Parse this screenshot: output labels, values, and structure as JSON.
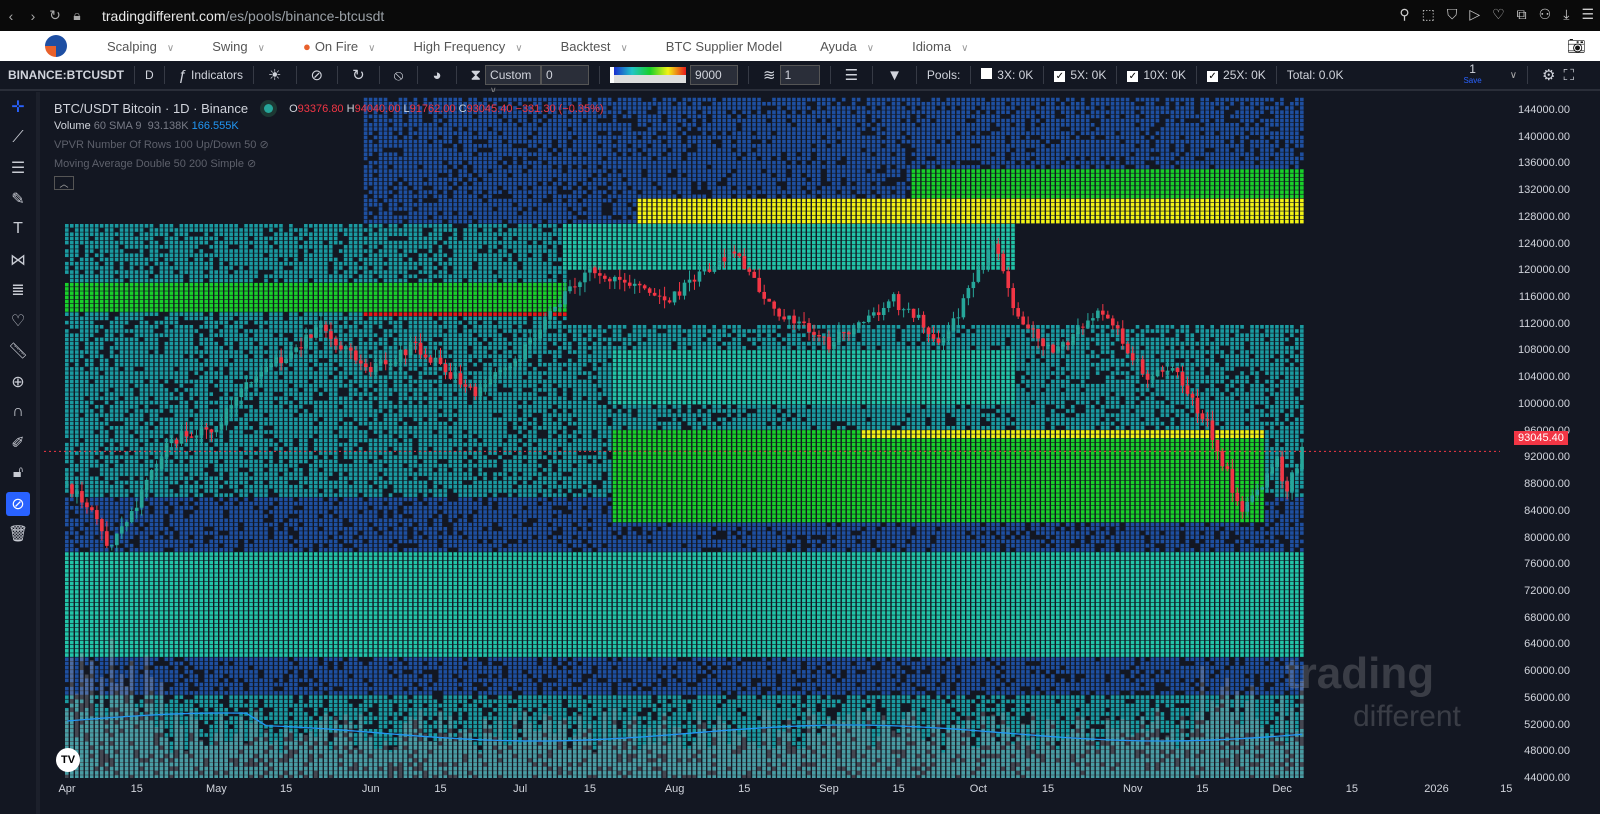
{
  "browser": {
    "url_host": "tradingdifferent.com",
    "url_path": "/es/pools/binance-btcusdt"
  },
  "menu": {
    "items": [
      "Scalping",
      "Swing",
      "On Fire",
      "High Frequency",
      "Backtest",
      "BTC Supplier Model",
      "Ayuda",
      "Idioma"
    ]
  },
  "toolbar": {
    "symbol": "BINANCE:BTCUSDT",
    "interval": "D",
    "indicators": "Indicators",
    "range_mode": "Custom",
    "range_value": "0",
    "heat_value": "9000",
    "layers_value": "1",
    "pools_label": "Pools:",
    "pools": [
      {
        "label": "3X: 0K",
        "checked": false
      },
      {
        "label": "5X: 0K",
        "checked": true
      },
      {
        "label": "10X: 0K",
        "checked": true
      },
      {
        "label": "25X: 0K",
        "checked": true
      }
    ],
    "total": "Total: 0.0K",
    "layout_num": "1",
    "save": "Save"
  },
  "legend": {
    "title": "BTC/USDT Bitcoin · 1D · Binance",
    "o_label": "O",
    "o": "93376.80",
    "h_label": "H",
    "h": "94040.00",
    "l_label": "L",
    "l": "91762.00",
    "c_label": "C",
    "c": "93045.40",
    "change": "−331.30 (−0.35%)",
    "volume_label": "Volume",
    "volume_params": "60 SMA 9",
    "volume_value": "93.138K",
    "volume_sma": "166.555K",
    "vpvr": "VPVR Number Of Rows 100 Up/Down 50",
    "ma": "Moving Average Double 50 200 Simple"
  },
  "watermark": {
    "line1": "trading",
    "line2": "different"
  },
  "colors": {
    "bg": "#131722",
    "up": "#26a69a",
    "down": "#f23645",
    "heat": [
      "#1a3a8a",
      "#1e4fa0",
      "#1a9aa0",
      "#22c4a8",
      "#19d02a",
      "#f2f215",
      "#e81818"
    ]
  },
  "chart_data": {
    "type": "candlestick-heatmap",
    "symbol": "BTC/USDT",
    "interval": "1D",
    "last_price": "93045.40",
    "ylim": [
      42000,
      146000
    ],
    "price_ticks": [
      "144000.00",
      "140000.00",
      "136000.00",
      "132000.00",
      "128000.00",
      "124000.00",
      "120000.00",
      "116000.00",
      "112000.00",
      "108000.00",
      "104000.00",
      "100000.00",
      "96000.00",
      "92000.00",
      "88000.00",
      "84000.00",
      "80000.00",
      "76000.00",
      "72000.00",
      "68000.00",
      "64000.00",
      "60000.00",
      "56000.00",
      "52000.00",
      "48000.00",
      "44000.00"
    ],
    "price_tick_values": [
      144000,
      140000,
      136000,
      132000,
      128000,
      124000,
      120000,
      116000,
      112000,
      108000,
      104000,
      100000,
      96000,
      92000,
      88000,
      84000,
      80000,
      76000,
      72000,
      68000,
      64000,
      60000,
      56000,
      52000,
      48000,
      44000
    ],
    "time_ticks": [
      {
        "label": "Apr",
        "day": 0
      },
      {
        "label": "15",
        "day": 14
      },
      {
        "label": "May",
        "day": 30
      },
      {
        "label": "15",
        "day": 44
      },
      {
        "label": "Jun",
        "day": 61
      },
      {
        "label": "15",
        "day": 75
      },
      {
        "label": "Jul",
        "day": 91
      },
      {
        "label": "15",
        "day": 105
      },
      {
        "label": "Aug",
        "day": 122
      },
      {
        "label": "15",
        "day": 136
      },
      {
        "label": "Sep",
        "day": 153
      },
      {
        "label": "15",
        "day": 167
      },
      {
        "label": "Oct",
        "day": 183
      },
      {
        "label": "15",
        "day": 197
      },
      {
        "label": "Nov",
        "day": 214
      },
      {
        "label": "15",
        "day": 228
      },
      {
        "label": "Dec",
        "day": 244
      },
      {
        "label": "15",
        "day": 258
      },
      {
        "label": "2026",
        "day": 275
      },
      {
        "label": "15",
        "day": 289
      }
    ],
    "close_keypoints": [
      [
        0,
        88000
      ],
      [
        6,
        82800
      ],
      [
        8,
        78500
      ],
      [
        14,
        85500
      ],
      [
        21,
        94700
      ],
      [
        30,
        97000
      ],
      [
        37,
        103700
      ],
      [
        51,
        111500
      ],
      [
        61,
        105000
      ],
      [
        70,
        109000
      ],
      [
        82,
        101500
      ],
      [
        91,
        107500
      ],
      [
        100,
        116500
      ],
      [
        104,
        120000
      ],
      [
        121,
        115700
      ],
      [
        134,
        123500
      ],
      [
        141,
        115000
      ],
      [
        153,
        109000
      ],
      [
        166,
        115700
      ],
      [
        176,
        109500
      ],
      [
        186,
        124000
      ],
      [
        191,
        113000
      ],
      [
        198,
        108000
      ],
      [
        208,
        114000
      ],
      [
        217,
        103700
      ],
      [
        222,
        106000
      ],
      [
        229,
        97000
      ],
      [
        236,
        84000
      ],
      [
        243,
        91500
      ],
      [
        245,
        87000
      ],
      [
        248,
        93045
      ]
    ],
    "heatmap_zones": [
      {
        "from": 127000,
        "to": 130500,
        "start_day": 115,
        "end_day": 248,
        "level": 5
      },
      {
        "from": 128300,
        "to": 129700,
        "start_day": 190,
        "end_day": 248,
        "level": 6
      },
      {
        "from": 113500,
        "to": 118000,
        "start_day": 0,
        "end_day": 100,
        "level": 4
      },
      {
        "from": 113500,
        "to": 116500,
        "start_day": 30,
        "end_day": 100,
        "level": 5
      },
      {
        "from": 113000,
        "to": 116000,
        "start_day": 60,
        "end_day": 100,
        "level": 6
      },
      {
        "from": 95000,
        "to": 96200,
        "start_day": 160,
        "end_day": 240,
        "level": 5
      },
      {
        "from": 82000,
        "to": 96000,
        "start_day": 110,
        "end_day": 240,
        "level": 4
      },
      {
        "from": 130500,
        "to": 135000,
        "start_day": 170,
        "end_day": 248,
        "level": 4
      },
      {
        "from": 100000,
        "to": 108000,
        "start_day": 110,
        "end_day": 190,
        "level": 3
      },
      {
        "from": 62000,
        "to": 78000,
        "start_day": 0,
        "end_day": 248,
        "level": 3
      },
      {
        "from": 56000,
        "to": 62000,
        "start_day": 0,
        "end_day": 248,
        "level": 1
      },
      {
        "from": 44000,
        "to": 56000,
        "start_day": 0,
        "end_day": 248,
        "level": 2
      },
      {
        "from": 120000,
        "to": 127000,
        "start_day": 100,
        "end_day": 190,
        "level": 3
      },
      {
        "from": 86000,
        "to": 112000,
        "start_day": 0,
        "end_day": 248,
        "level": 2
      },
      {
        "from": 112000,
        "to": 127000,
        "start_day": 0,
        "end_day": 100,
        "level": 2
      },
      {
        "from": 127000,
        "to": 146000,
        "start_day": 60,
        "end_day": 248,
        "level": 1
      },
      {
        "from": 78000,
        "to": 86000,
        "start_day": 0,
        "end_day": 248,
        "level": 1
      }
    ]
  }
}
